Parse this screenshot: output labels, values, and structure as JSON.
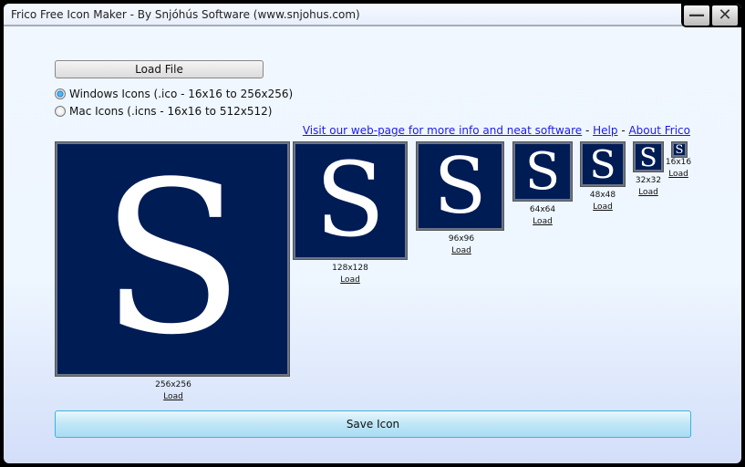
{
  "window": {
    "title": "Frico Free Icon Maker - By Snjóhús Software (www.snjohus.com)",
    "minimize": "—",
    "close": "✕"
  },
  "load_file": "Load File",
  "formats": [
    {
      "label": "Windows Icons (.ico - 16x16 to 256x256)",
      "selected": true
    },
    {
      "label": "Mac Icons (.icns - 16x16 to 512x512)",
      "selected": false
    }
  ],
  "links": {
    "visit": "Visit our web-page for more info and neat software",
    "sep": " - ",
    "help": "Help",
    "about": "About Frico"
  },
  "icons": [
    {
      "size": "256x256",
      "load": "Load",
      "glyph": "S"
    },
    {
      "size": "128x128",
      "load": "Load",
      "glyph": "S"
    },
    {
      "size": "96x96",
      "load": "Load",
      "glyph": "S"
    },
    {
      "size": "64x64",
      "load": "Load",
      "glyph": "S"
    },
    {
      "size": "48x48",
      "load": "Load",
      "glyph": "S"
    },
    {
      "size": "32x32",
      "load": "Load",
      "glyph": "S"
    },
    {
      "size": "16x16",
      "load": "Load",
      "glyph": "S"
    }
  ],
  "save": "Save Icon"
}
